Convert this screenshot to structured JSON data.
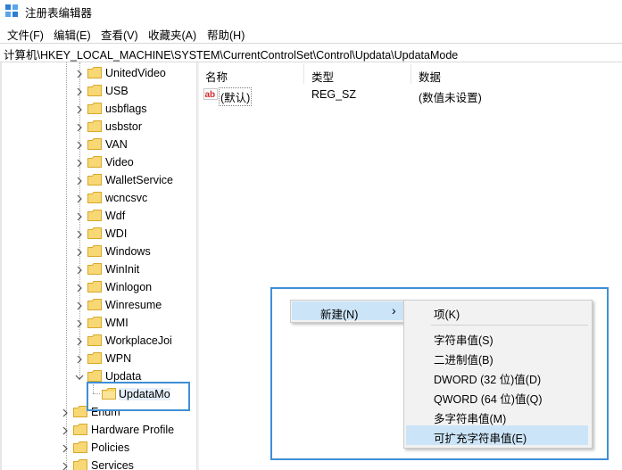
{
  "window": {
    "title": "注册表编辑器"
  },
  "menu": [
    "文件(F)",
    "编辑(E)",
    "查看(V)",
    "收藏夹(A)",
    "帮助(H)"
  ],
  "address": "计算机\\HKEY_LOCAL_MACHINE\\SYSTEM\\CurrentControlSet\\Control\\Updata\\UpdataMode",
  "tree": {
    "items": [
      "UnitedVideo",
      "USB",
      "usbflags",
      "usbstor",
      "VAN",
      "Video",
      "WalletService",
      "wcncsvc",
      "Wdf",
      "WDI",
      "Windows",
      "WinInit",
      "Winlogon",
      "Winresume",
      "WMI",
      "WorkplaceJoi",
      "WPN",
      "Updata"
    ],
    "selected_child": "UpdataMo",
    "lower_items": [
      "Enum",
      "Hardware Profile",
      "Policies",
      "Services"
    ]
  },
  "list": {
    "headers": [
      "名称",
      "类型",
      "数据"
    ],
    "rows": [
      {
        "name": "(默认)",
        "type": "REG_SZ",
        "data": "(数值未设置)"
      }
    ]
  },
  "context_menu": {
    "new_label": "新建(N)",
    "arrow": "›"
  },
  "submenu": {
    "key": "项(K)",
    "items": [
      "字符串值(S)",
      "二进制值(B)",
      "DWORD (32 位)值(D)",
      "QWORD (64 位)值(Q)",
      "多字符串值(M)",
      "可扩充字符串值(E)"
    ]
  },
  "colors": {
    "highlight_box": "#3f8fd6",
    "menu_highlight": "#cce4f7",
    "folder": "#f8d775"
  }
}
